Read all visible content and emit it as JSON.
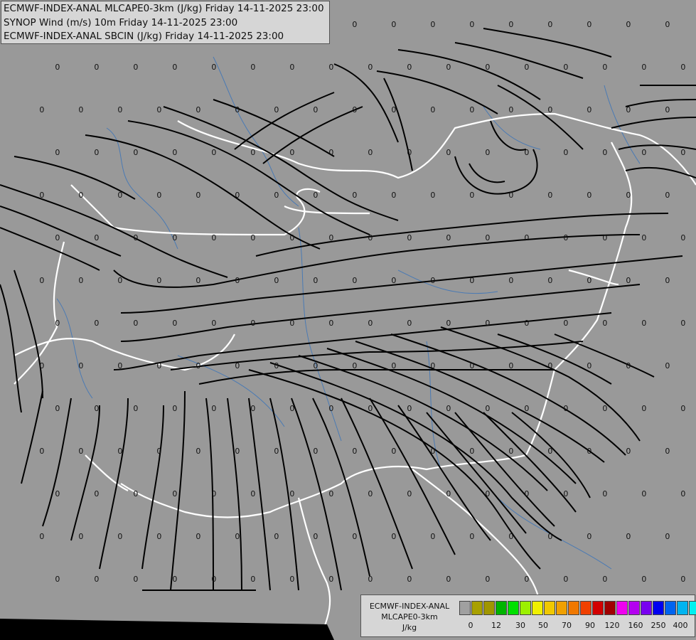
{
  "header": {
    "line1": "ECMWF-INDEX-ANAL MLCAPE0-3km (J/kg) Friday 14-11-2025 23:00",
    "line2": "SYNOP Wind (m/s) 10m Friday 14-11-2025 23:00",
    "line3": "ECMWF-INDEX-ANAL SBCIN (J/kg) Friday 14-11-2025 23:00"
  },
  "legend": {
    "title_line1": "ECMWF-INDEX-ANAL",
    "title_line2": "MLCAPE0-3km",
    "unit": "J/kg",
    "colors": [
      "#a0a0a0",
      "#a8a000",
      "#a09600",
      "#00b400",
      "#00e000",
      "#9cf000",
      "#f0f000",
      "#f0c800",
      "#f0a000",
      "#f07800",
      "#f04000",
      "#d20000",
      "#a00000",
      "#f000f0",
      "#b400f0",
      "#7800f0",
      "#0000f0",
      "#0064f0",
      "#00b4f0",
      "#00f0f0",
      "#96f0f0",
      "#ffffff"
    ],
    "ticks": [
      "0",
      "12",
      "30",
      "50",
      "70",
      "90",
      "120",
      "160",
      "250",
      "400"
    ]
  },
  "map": {
    "field_label": "0",
    "background": "#999999",
    "border_color": "#ffffff",
    "river_color": "#4a7ab4",
    "streamline_color": "#000000"
  }
}
